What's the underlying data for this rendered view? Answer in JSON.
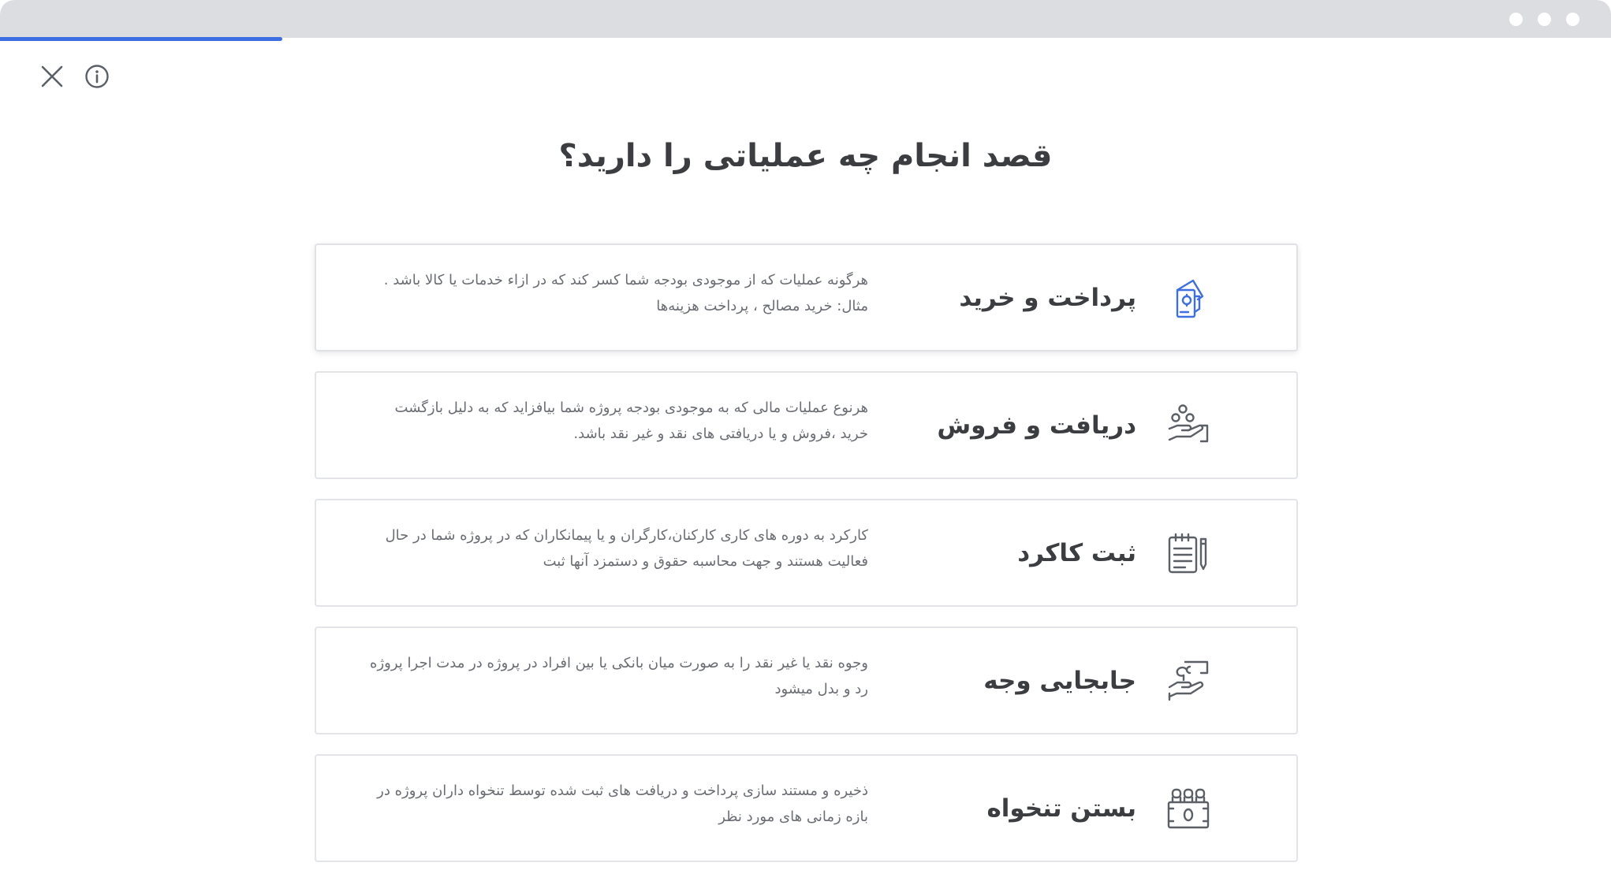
{
  "window": {
    "progress_percent": 17.5,
    "accent_color": "#3d6fe3",
    "icon_color_active": "#3d6fe3",
    "icon_color_default": "#5b5f66"
  },
  "toolbar": {
    "close_icon": "close-icon",
    "info_icon": "info-icon"
  },
  "page": {
    "title": "قصد انجام چه عملیاتی را دارید؟"
  },
  "options": [
    {
      "title": "پرداخت و خرید",
      "description": "هرگونه عملیات که از موجودی بودجه شما کسر کند که در ازاء خدمات یا کالا باشد . مثال: خرید مصالح ، پرداخت هزینه‌ها",
      "icon": "payment-receipt-icon",
      "selected": true
    },
    {
      "title": "دریافت و فروش",
      "description": "هرنوع عملیات مالی که به موجودی بودجه پروژه شما بیافزاید که به دلیل بازگشت خرید ،فروش و یا دریافتی های نقد و غیر نقد باشد.",
      "icon": "receive-coins-hand-icon",
      "selected": false
    },
    {
      "title": "ثبت کاکرد",
      "description": "کارکرد به دوره های کاری کارکنان،کارگران و یا پیمانکاران که در پروژه شما در حال فعالیت هستند و جهت محاسبه حقوق و دستمزد آنها ثبت",
      "icon": "worklog-notepad-icon",
      "selected": false
    },
    {
      "title": "جابجایی وجه",
      "description": "وجوه نقد یا غیر نقد را به صورت میان بانکی یا بین افراد در پروژه در مدت اجرا پروژه رد و بدل میشود",
      "icon": "money-transfer-hand-icon",
      "selected": false
    },
    {
      "title": "بستن تنخواه",
      "description": "ذخیره و مستند سازی پرداخت و دریافت های ثبت شده توسط تنخواه داران پروژه در بازه زمانی های مورد نظر",
      "icon": "petty-cash-icon",
      "selected": false
    }
  ]
}
